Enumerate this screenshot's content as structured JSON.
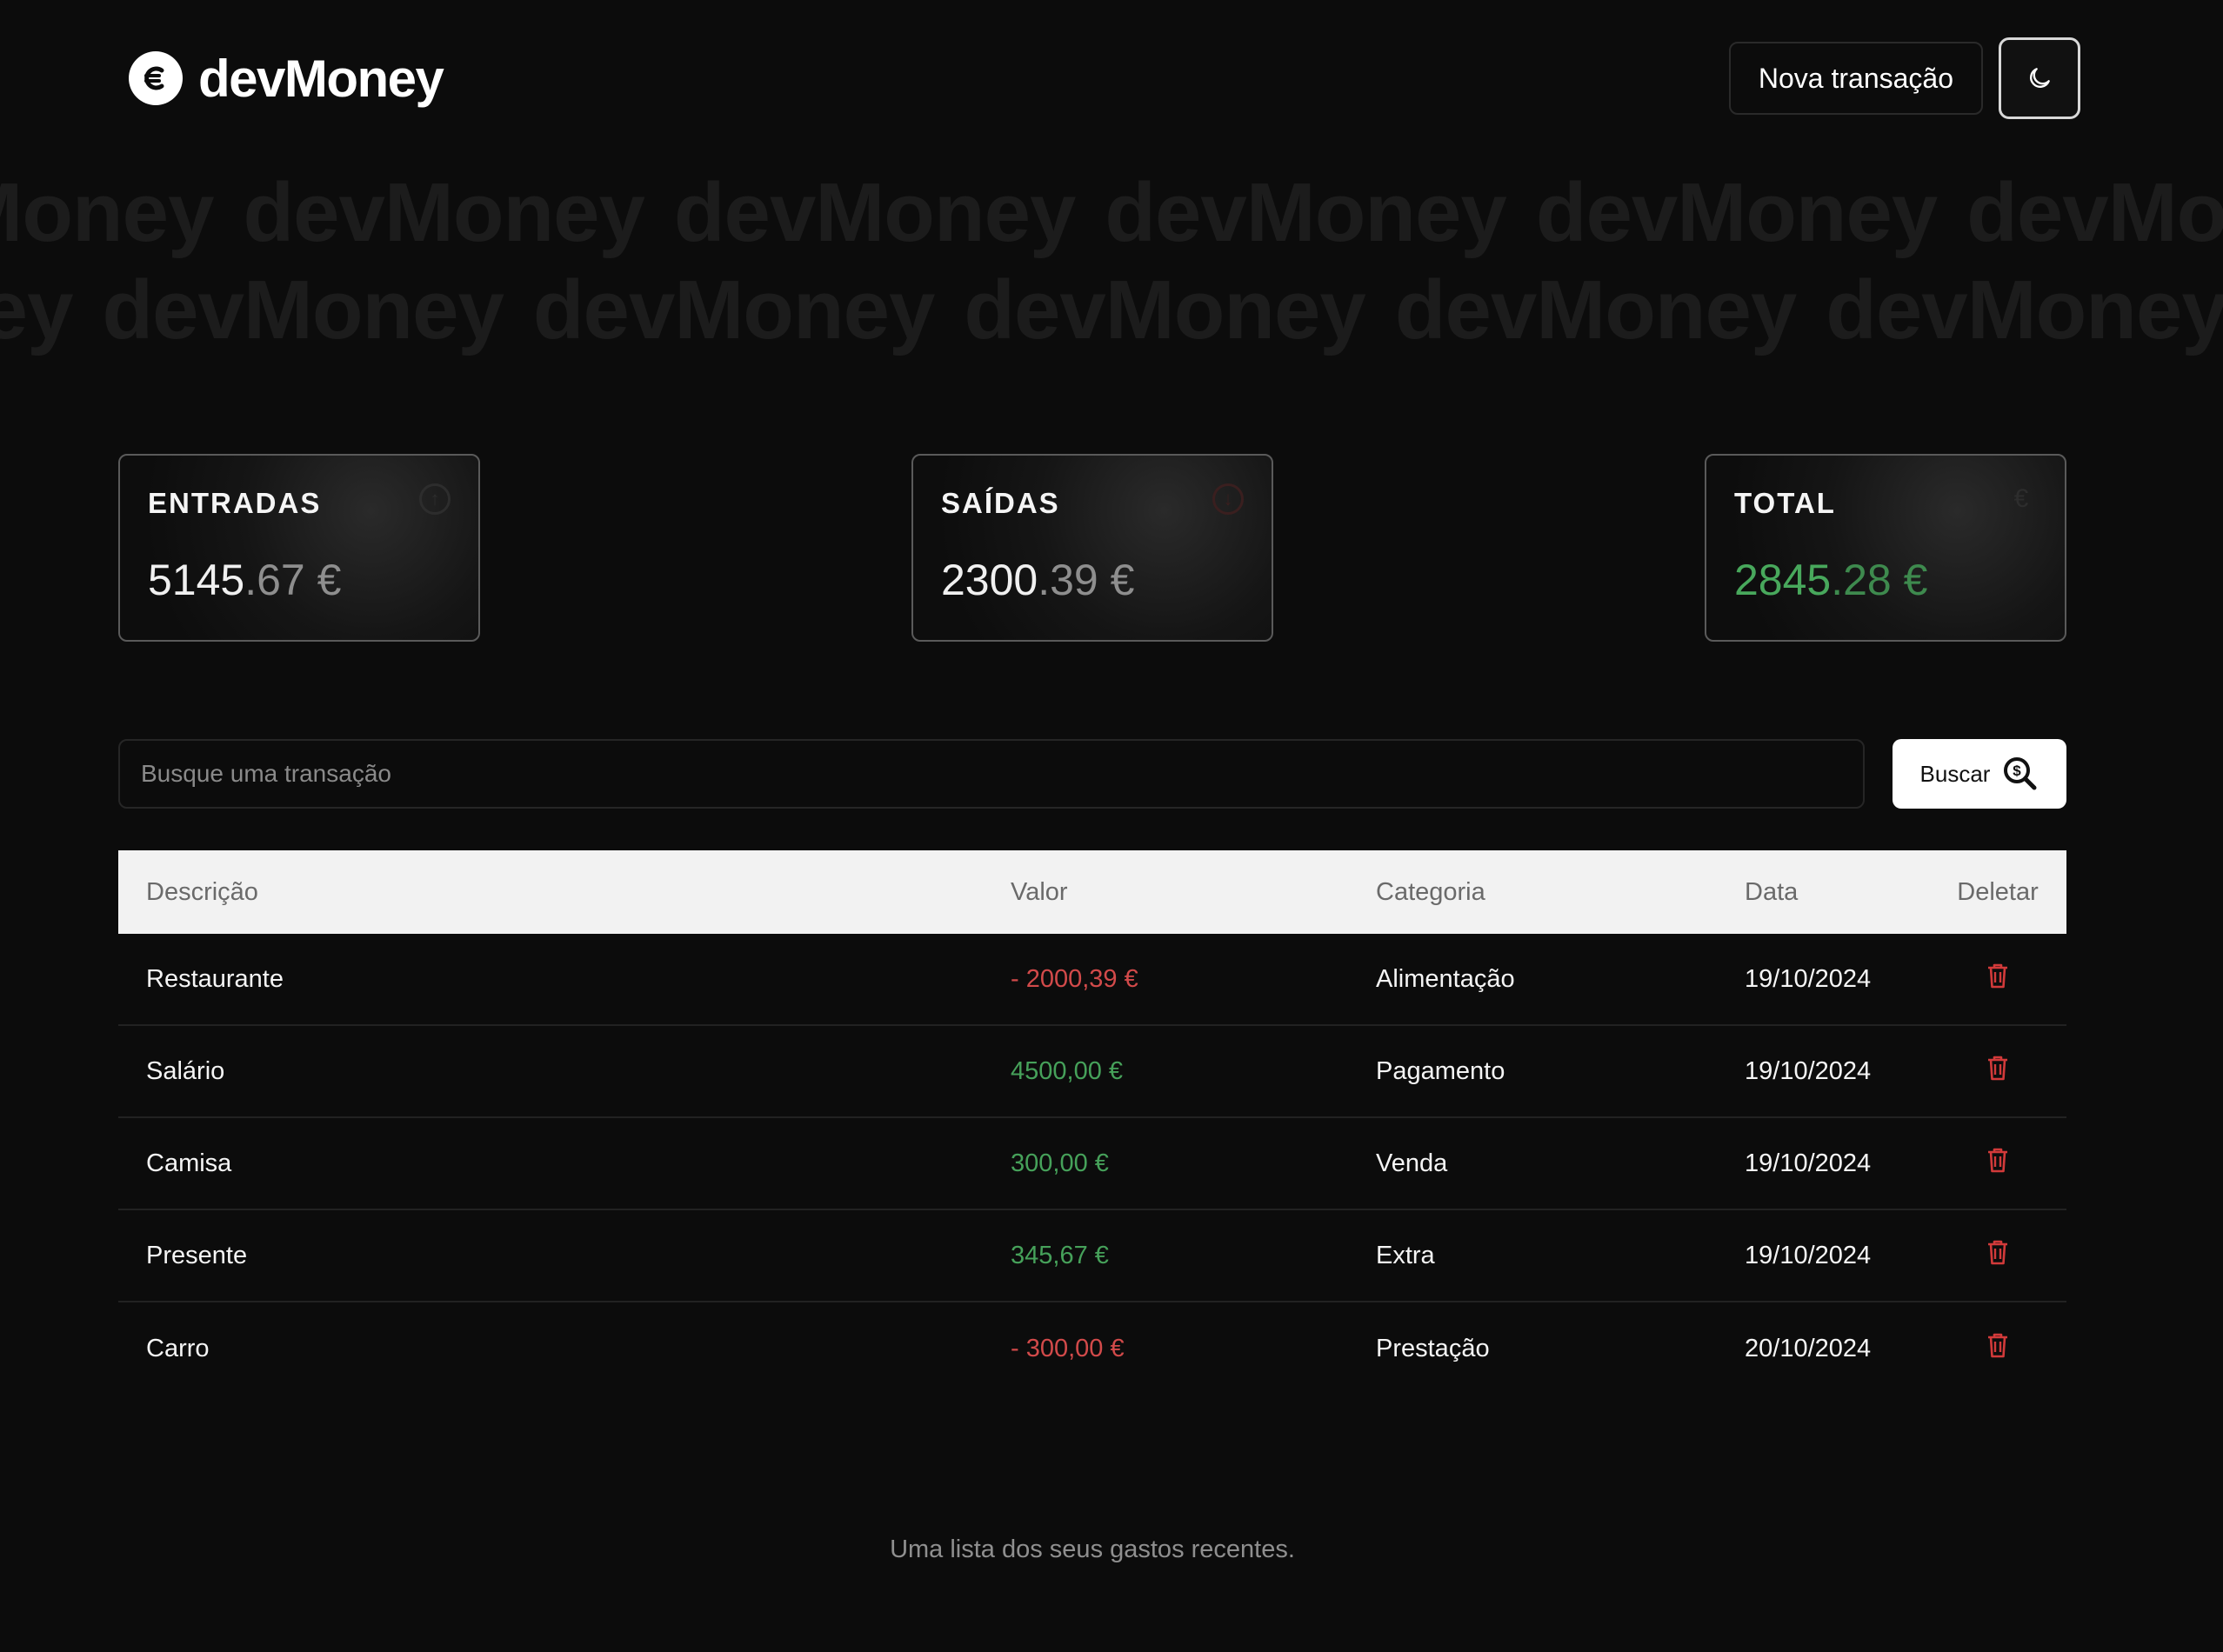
{
  "brand": {
    "name": "devMoney"
  },
  "header": {
    "new_transaction_label": "Nova transação",
    "theme_toggle_icon": "moon-icon"
  },
  "watermark": {
    "text": "devMoney"
  },
  "summary": {
    "income": {
      "label": "ENTRADAS",
      "value_int": "5145",
      "value_dec": ".67 €",
      "icon": "arrow-up-circle-icon"
    },
    "expenses": {
      "label": "SAÍDAS",
      "value_int": "2300",
      "value_dec": ".39 €",
      "icon": "arrow-down-circle-icon"
    },
    "total": {
      "label": "TOTAL",
      "value_int": "2845",
      "value_dec": ".28 €",
      "icon": "euro-icon",
      "color": "#48a85c"
    }
  },
  "search": {
    "placeholder": "Busque uma transação",
    "button_label": "Buscar"
  },
  "table": {
    "headers": {
      "description": "Descrição",
      "value": "Valor",
      "category": "Categoria",
      "date": "Data",
      "delete": "Deletar"
    },
    "rows": [
      {
        "description": "Restaurante",
        "value": "- 2000,39 €",
        "type": "expense",
        "category": "Alimentação",
        "date": "19/10/2024"
      },
      {
        "description": "Salário",
        "value": "4500,00 €",
        "type": "income",
        "category": "Pagamento",
        "date": "19/10/2024"
      },
      {
        "description": "Camisa",
        "value": "300,00 €",
        "type": "income",
        "category": "Venda",
        "date": "19/10/2024"
      },
      {
        "description": "Presente",
        "value": "345,67 €",
        "type": "income",
        "category": "Extra",
        "date": "19/10/2024"
      },
      {
        "description": "Carro",
        "value": "- 300,00 €",
        "type": "expense",
        "category": "Prestação",
        "date": "20/10/2024"
      }
    ],
    "caption": "Uma lista dos seus gastos recentes."
  },
  "colors": {
    "income": "#46a15a",
    "expense": "#d24a4a",
    "background": "#0c0c0c"
  }
}
